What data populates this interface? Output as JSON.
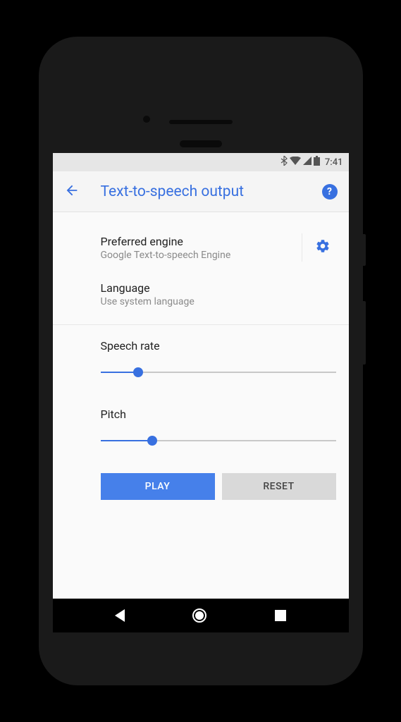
{
  "status": {
    "time": "7:41"
  },
  "header": {
    "title": "Text-to-speech output"
  },
  "engine": {
    "title": "Preferred engine",
    "subtitle": "Google Text-to-speech Engine"
  },
  "language": {
    "title": "Language",
    "subtitle": "Use system language"
  },
  "speechRate": {
    "label": "Speech rate",
    "value": 16
  },
  "pitch": {
    "label": "Pitch",
    "value": 22
  },
  "buttons": {
    "play": "PLAY",
    "reset": "RESET"
  },
  "colors": {
    "accent": "#3870e0"
  }
}
